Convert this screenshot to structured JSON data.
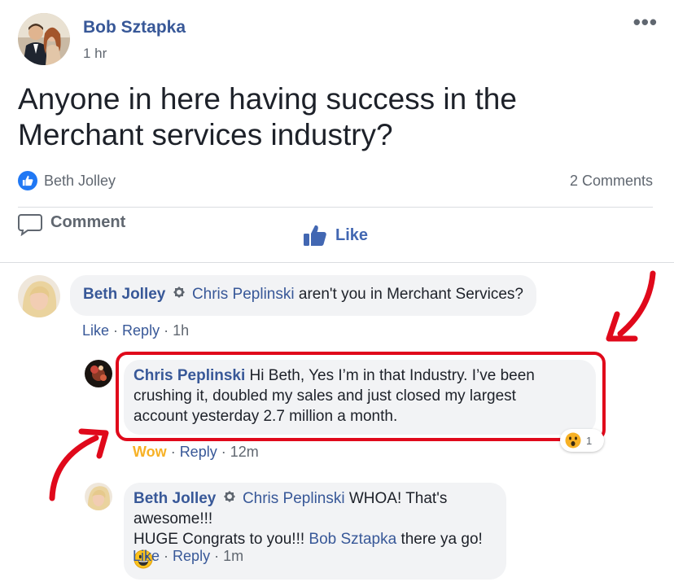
{
  "post": {
    "author": "Bob Sztapka",
    "time": "1 hr",
    "text_line1": "Anyone in here having success in the",
    "text_line2": "Merchant services industry?",
    "reactor": "Beth Jolley",
    "comment_count": "2 Comments",
    "like_label": "Like",
    "comment_label": "Comment"
  },
  "comments": [
    {
      "author": "Beth Jolley",
      "mention": "Chris Peplinski",
      "text": " aren't you in Merchant Services?",
      "like": "Like",
      "reply": "Reply",
      "time": "1h"
    },
    {
      "author": "Chris Peplinski",
      "text_line1": " Hi Beth, Yes I’m in that Industry. I’ve been",
      "text_line2": "crushing it, doubled my sales and just closed my largest",
      "text_line3": "account yesterday 2.7 million a month.",
      "reaction": "Wow",
      "reply": "Reply",
      "time": "12m",
      "reaction_count": "1"
    },
    {
      "author": "Beth Jolley",
      "mention": "Chris Peplinski",
      "text_line1": " WHOA! That's awesome!!!",
      "text_line2a": "HUGE Congrats to you!!! ",
      "mention2": "Bob Sztapka",
      "text_line2b": " there ya go! ",
      "like": "Like",
      "reply": "Reply",
      "time": "1m"
    }
  ],
  "icons": {
    "more": "more-options-icon",
    "like_badge": "like-reaction-icon",
    "like": "thumbs-up-icon",
    "comment": "speech-bubble-icon",
    "admin": "badge-icon",
    "wow": "wow-emoji-icon",
    "grin": "grinning-emoji-icon",
    "arrow": "red-arrow-annotation"
  },
  "colors": {
    "name_blue": "#385898",
    "like_blue": "#4267b2",
    "annotation_red": "#e0091b",
    "wow_yellow": "#f7b125"
  }
}
